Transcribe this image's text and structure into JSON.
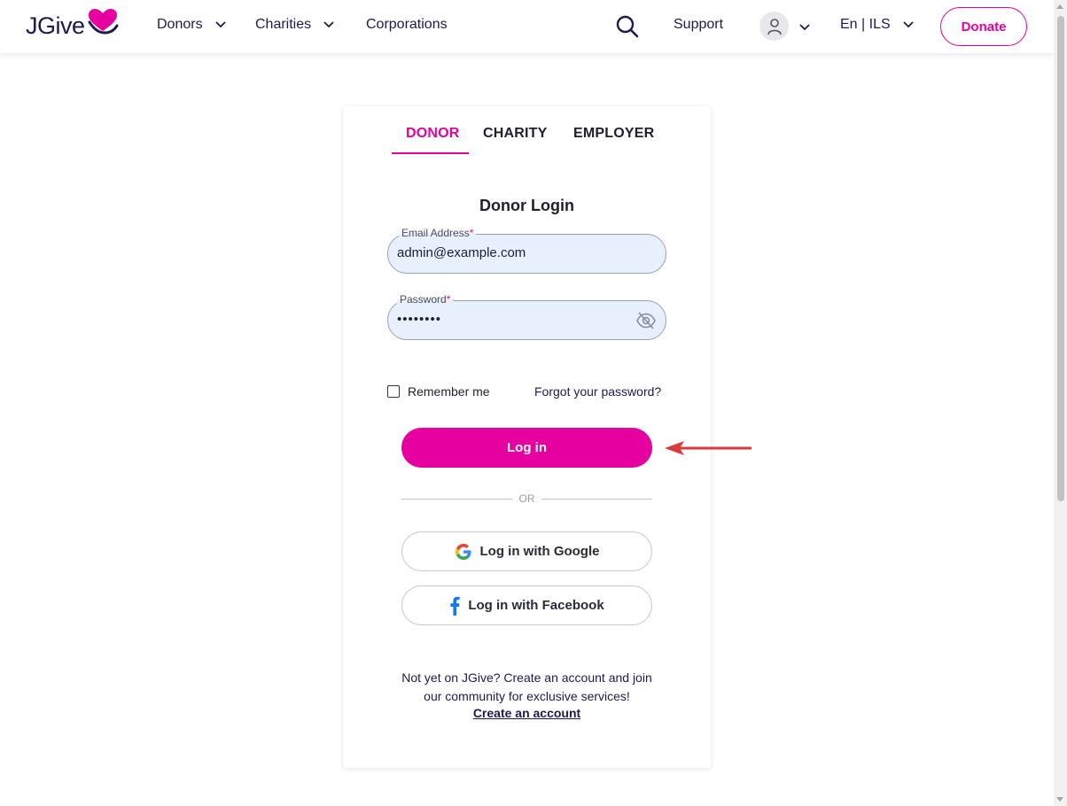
{
  "header": {
    "logo_text": "JGive",
    "nav": [
      {
        "label": "Donors"
      },
      {
        "label": "Charities"
      },
      {
        "label": "Corporations"
      }
    ],
    "support_label": "Support",
    "language_label": "En | ILS",
    "donate_label": "Donate"
  },
  "login": {
    "tabs": [
      {
        "label": "DONOR",
        "active": true
      },
      {
        "label": "CHARITY",
        "active": false
      },
      {
        "label": "EMPLOYER",
        "active": false
      }
    ],
    "title": "Donor Login",
    "email": {
      "label": "Email Address",
      "required_mark": "*",
      "value": "admin@example.com"
    },
    "password": {
      "label": "Password",
      "required_mark": "*",
      "masked_value": "••••••••"
    },
    "remember_label": "Remember me",
    "remember_checked": false,
    "forgot_label": "Forgot your password?",
    "login_label": "Log in",
    "or_label": "OR",
    "google_label": "Log in with Google",
    "facebook_label": "Log in with Facebook",
    "signup_text_line1": "Not yet on JGive? Create an account and join",
    "signup_text_line2": "our community for exclusive services!",
    "signup_link": "Create an account"
  },
  "colors": {
    "brand": "#e6009f",
    "navy": "#1c1b4f",
    "field_bg": "#e8f0fd",
    "annotation_arrow": "#d93a3a"
  },
  "icons": [
    "heart-logo-icon",
    "chevron-down-icon",
    "search-icon",
    "user-icon",
    "eye-off-icon",
    "google-icon",
    "facebook-icon",
    "red-arrow-annotation"
  ]
}
